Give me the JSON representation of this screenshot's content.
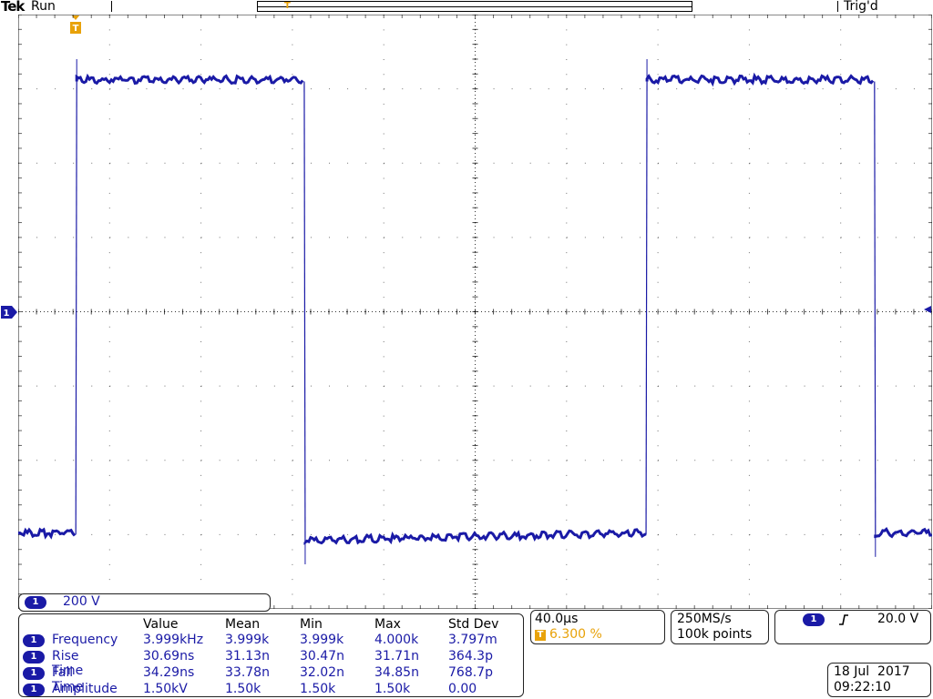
{
  "header": {
    "brand": "Tek",
    "run_status": "Run",
    "trigger_status": "Trig'd"
  },
  "channel": {
    "label": "1",
    "scale": "200 V"
  },
  "timebase": {
    "horizontal_scale": "40.0μs",
    "trigger_position": "6.300 %",
    "sample_rate": "250MS/s",
    "record_length": "100k points"
  },
  "trigger": {
    "source": "1",
    "level": "20.0 V"
  },
  "datetime": {
    "date": "18 Jul  2017",
    "time": "09:22:10"
  },
  "measurements": {
    "columns": [
      "Value",
      "Mean",
      "Min",
      "Max",
      "Std Dev"
    ],
    "rows": [
      {
        "name": "Frequency",
        "values": [
          "3.999kHz",
          "3.999k",
          "3.999k",
          "4.000k",
          "3.797m"
        ]
      },
      {
        "name": "Rise Time",
        "values": [
          "30.69ns",
          "31.13n",
          "30.47n",
          "31.71n",
          "364.3p"
        ]
      },
      {
        "name": "Fall Time",
        "values": [
          "34.29ns",
          "33.78n",
          "32.02n",
          "34.85n",
          "768.7p"
        ]
      },
      {
        "name": "Amplitude",
        "values": [
          "1.50kV",
          "1.50k",
          "1.50k",
          "1.50k",
          "0.00"
        ]
      }
    ]
  },
  "colors": {
    "trace": "#1a1aa6",
    "trigger": "#e8a20a",
    "grid": "#000000"
  },
  "icons": {
    "trigger_marker": "trigger-T-icon",
    "ground_marker": "channel-1-ground-icon",
    "edge": "rising-edge-icon"
  },
  "chart_data": {
    "type": "line",
    "title": "",
    "xlabel": "",
    "ylabel": "",
    "x_divisions": 10,
    "y_divisions": 8,
    "x_units_per_div": "40.0μs",
    "y_units_per_div": "200 V",
    "series": [
      {
        "points_div": [
          [
            0.0,
            -3.0
          ],
          [
            0.63,
            -3.0
          ],
          [
            0.64,
            3.1
          ],
          [
            3.13,
            3.1
          ],
          [
            3.14,
            -3.1
          ],
          [
            6.87,
            -3.0
          ],
          [
            6.88,
            3.1
          ],
          [
            9.37,
            3.1
          ],
          [
            9.38,
            -3.0
          ],
          [
            10.0,
            -3.0
          ]
        ]
      }
    ]
  }
}
